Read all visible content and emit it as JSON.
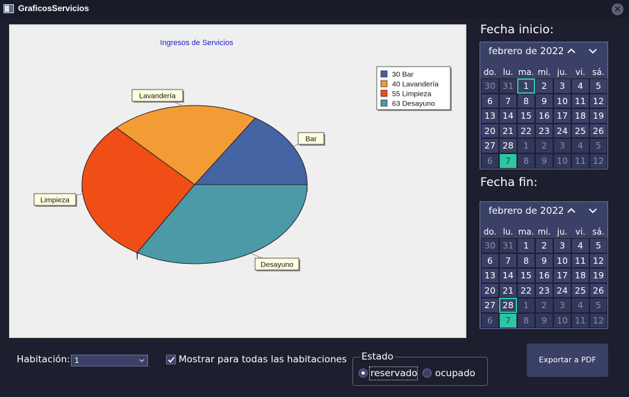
{
  "window": {
    "title": "GraficosServicios",
    "close_icon": "close-circle-icon"
  },
  "chart_data": {
    "type": "pie",
    "title": "Ingresos de Servicios",
    "categories": [
      "Bar",
      "Lavandería",
      "Limpieza",
      "Desayuno"
    ],
    "values": [
      30,
      40,
      55,
      63
    ],
    "legend": [
      "30 Bar",
      "40 Lavandería",
      "55 Limpieza",
      "63 Desayuno"
    ],
    "colors": [
      "#4464a4",
      "#f39c35",
      "#f04e16",
      "#4c9aa7"
    ],
    "legend_position": "top-right",
    "style": "3d"
  },
  "fecha_inicio": {
    "label": "Fecha inicio:",
    "month": "febrero de 2022",
    "days_of_week": [
      "do.",
      "lu.",
      "ma.",
      "mi.",
      "ju.",
      "vi.",
      "sá."
    ],
    "days": [
      "30",
      "31",
      "1",
      "2",
      "3",
      "4",
      "5",
      "6",
      "7",
      "8",
      "9",
      "10",
      "11",
      "12",
      "13",
      "14",
      "15",
      "16",
      "17",
      "18",
      "19",
      "20",
      "21",
      "22",
      "23",
      "24",
      "25",
      "26",
      "27",
      "28",
      "1",
      "2",
      "3",
      "4",
      "5",
      "6",
      "7",
      "8",
      "9",
      "10",
      "11",
      "12"
    ],
    "selected_day": "1",
    "today_day": "7"
  },
  "fecha_fin": {
    "label": "Fecha fin:",
    "month": "febrero de 2022",
    "days_of_week": [
      "do.",
      "lu.",
      "ma.",
      "mi.",
      "ju.",
      "vi.",
      "sá."
    ],
    "days": [
      "30",
      "31",
      "1",
      "2",
      "3",
      "4",
      "5",
      "6",
      "7",
      "8",
      "9",
      "10",
      "11",
      "12",
      "13",
      "14",
      "15",
      "16",
      "17",
      "18",
      "19",
      "20",
      "21",
      "22",
      "23",
      "24",
      "25",
      "26",
      "27",
      "28",
      "1",
      "2",
      "3",
      "4",
      "5",
      "6",
      "7",
      "8",
      "9",
      "10",
      "11",
      "12"
    ],
    "selected_day": "28",
    "today_day": "7"
  },
  "controls": {
    "habitacion_label": "Habitación:",
    "habitacion_value": "1",
    "mostrar_label": "Mostrar para todas las habitaciones",
    "mostrar_checked": true,
    "estado_label": "Estado",
    "estado_options": [
      "reservado",
      "ocupado"
    ],
    "estado_selected": "reservado",
    "export_label": "Exportar a PDF"
  }
}
